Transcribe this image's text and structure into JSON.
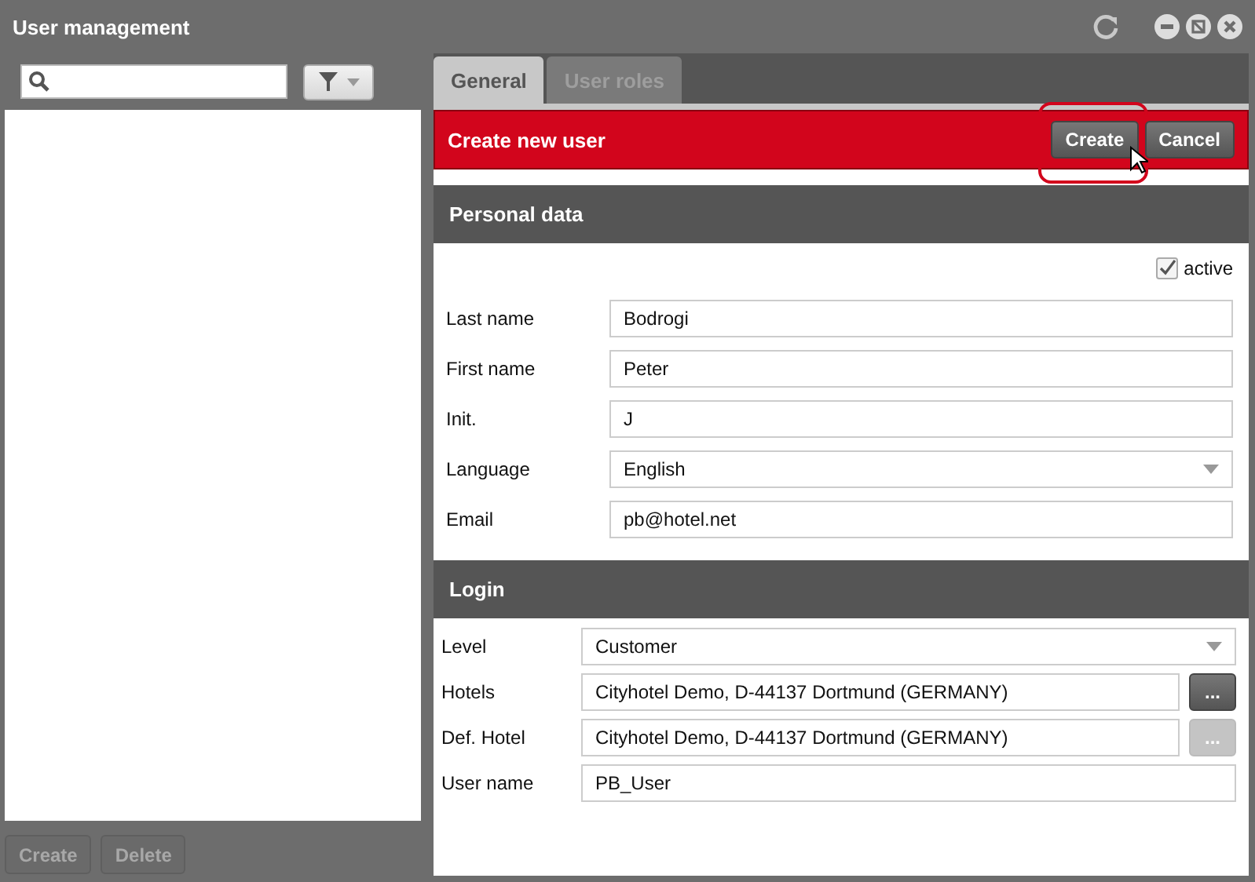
{
  "window": {
    "title": "User management"
  },
  "left_panel": {
    "buttons": [
      {
        "label": "Create",
        "disabled": true
      },
      {
        "label": "Delete",
        "disabled": true
      }
    ]
  },
  "tabs": [
    {
      "label": "General",
      "selected": true
    },
    {
      "label": "User roles",
      "selected": false
    }
  ],
  "header": {
    "title": "Create new user",
    "buttons": [
      {
        "label": "Create",
        "highlighted": true
      },
      {
        "label": "Cancel",
        "highlighted": false
      }
    ]
  },
  "personal_data": {
    "title": "Personal data",
    "active": {
      "label": "active",
      "checked": true
    },
    "fields": [
      {
        "label": "Last name",
        "kind": "text",
        "value": "Bodrogi"
      },
      {
        "label": "First name",
        "kind": "text",
        "value": "Peter"
      },
      {
        "label": "Init.",
        "kind": "text",
        "value": "J"
      },
      {
        "label": "Language",
        "kind": "select",
        "value": "English"
      },
      {
        "label": "Email",
        "kind": "text",
        "value": "pb@hotel.net"
      }
    ]
  },
  "login": {
    "title": "Login",
    "fields": [
      {
        "label": "Level",
        "kind": "select",
        "value": "Customer"
      },
      {
        "label": "Hotels",
        "kind": "browse",
        "value": "Cityhotel Demo, D-44137 Dortmund (GERMANY)",
        "button": "...",
        "disabled": false
      },
      {
        "label": "Def. Hotel",
        "kind": "browse",
        "value": "Cityhotel Demo, D-44137 Dortmund (GERMANY)",
        "button": "...",
        "disabled": true
      },
      {
        "label": "User name",
        "kind": "text",
        "value": "PB_User"
      }
    ]
  }
}
